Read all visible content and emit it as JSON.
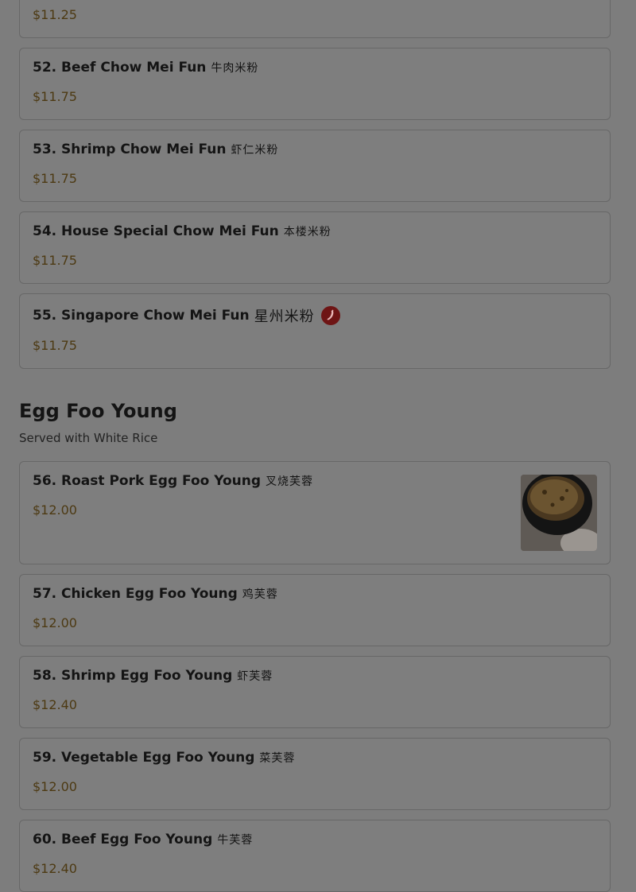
{
  "colors": {
    "background": "#7d7d7d",
    "price": "#4d3a13",
    "spicy_badge": "#6e1515"
  },
  "top_partial_item": {
    "price": "$11.25"
  },
  "items_top": [
    {
      "name": "52. Beef Chow Mei Fun",
      "cn": "牛肉米粉",
      "price": "$11.75"
    },
    {
      "name": "53. Shrimp Chow Mei Fun",
      "cn": "虾仁米粉",
      "price": "$11.75"
    },
    {
      "name": "54. House Special Chow Mei Fun",
      "cn": "本楼米粉",
      "price": "$11.75"
    },
    {
      "name": "55. Singapore Chow Mei Fun",
      "cn": "星州米粉",
      "price": "$11.75",
      "spicy_icon": "chili-pepper-icon"
    }
  ],
  "section": {
    "title": "Egg Foo Young",
    "subtitle": "Served with White Rice"
  },
  "items_egg_foo_young": [
    {
      "name": "56. Roast Pork Egg Foo Young",
      "cn": "叉烧芙蓉",
      "price": "$12.00",
      "has_image": true
    },
    {
      "name": "57. Chicken Egg Foo Young",
      "cn": "鸡芙蓉",
      "price": "$12.00"
    },
    {
      "name": "58. Shrimp Egg Foo Young",
      "cn": "虾芙蓉",
      "price": "$12.40"
    },
    {
      "name": "59. Vegetable Egg Foo Young",
      "cn": "菜芙蓉",
      "price": "$12.00"
    },
    {
      "name": "60. Beef Egg Foo Young",
      "cn": "牛芙蓉",
      "price": "$12.40"
    }
  ]
}
